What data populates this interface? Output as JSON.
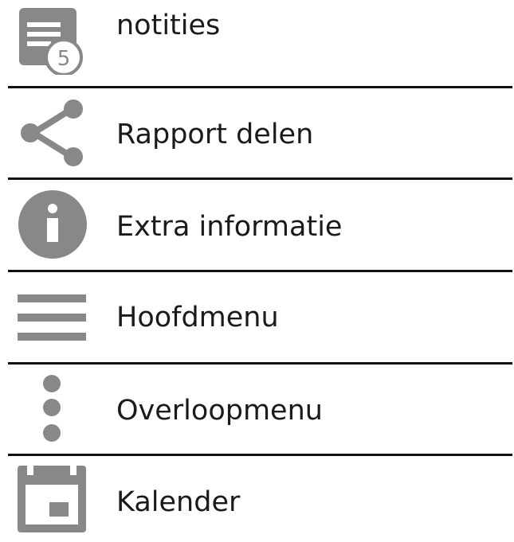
{
  "icon_color": "#888888",
  "divider_color": "#111111",
  "menu": {
    "items": [
      {
        "label": "notities",
        "icon": "notes-icon",
        "badge": "5"
      },
      {
        "label": "Rapport delen",
        "icon": "share-icon"
      },
      {
        "label": "Extra informatie",
        "icon": "info-icon"
      },
      {
        "label": "Hoofdmenu",
        "icon": "hamburger-menu-icon"
      },
      {
        "label": "Overloopmenu",
        "icon": "overflow-menu-icon"
      },
      {
        "label": "Kalender",
        "icon": "calendar-icon"
      }
    ]
  }
}
